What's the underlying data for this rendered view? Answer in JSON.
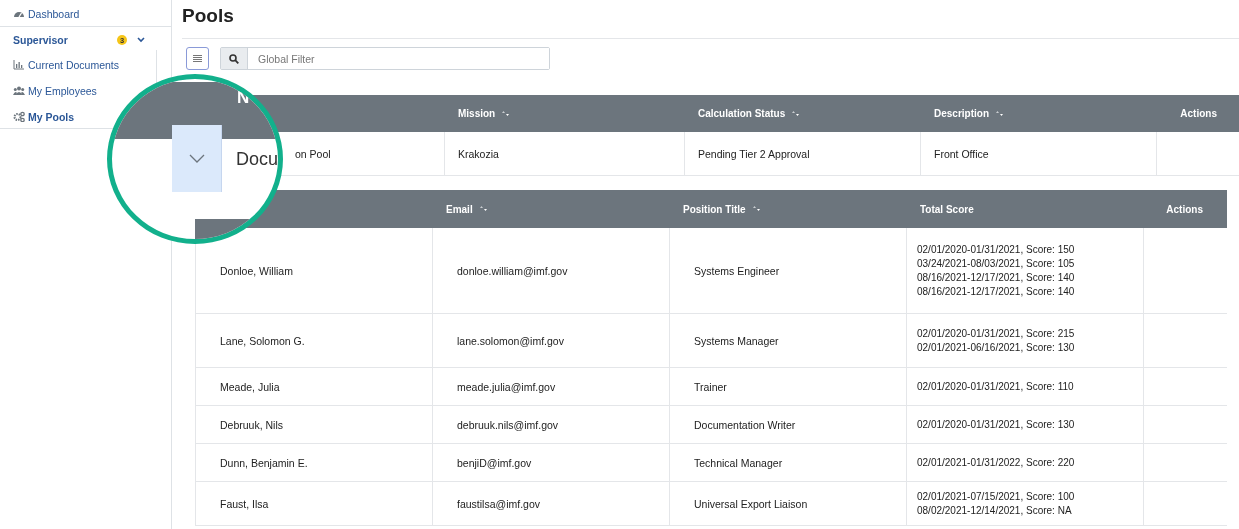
{
  "sidebar": {
    "items": [
      {
        "kind": "link",
        "label": "Dashboard",
        "selected": false
      },
      {
        "kind": "group",
        "label": "Supervisor",
        "badge": "3",
        "expanded": true,
        "children": [
          {
            "label": "Current Documents",
            "selected": false
          },
          {
            "label": "My Employees",
            "selected": false
          },
          {
            "label": "My Pools",
            "selected": true
          }
        ]
      }
    ]
  },
  "title": "Pools",
  "toolbar": {
    "filter_placeholder": "Global Filter"
  },
  "pools_table": {
    "columns": [
      {
        "label": "Mission",
        "sortable": true
      },
      {
        "label": "Calculation Status",
        "sortable": true
      },
      {
        "label": "Description",
        "sortable": true
      },
      {
        "label": "Actions",
        "sortable": false
      }
    ],
    "rows": [
      {
        "expanded": true,
        "name": "on Pool",
        "mission": "Krakozia",
        "calculation_status": "Pending Tier 2 Approval",
        "description": "Front Office"
      }
    ]
  },
  "magnifier": {
    "header_text": "N",
    "row_text": "Docu"
  },
  "employees_table": {
    "columns": [
      {
        "label": "Email",
        "sortable": true
      },
      {
        "label": "Position Title",
        "sortable": true
      },
      {
        "label": "Total Score",
        "sortable": false
      },
      {
        "label": "Actions",
        "sortable": false
      }
    ],
    "rows": [
      {
        "name": "Donloe, William",
        "email": "donloe.william@imf.gov",
        "position": "Systems Engineer",
        "scores": [
          "02/01/2020-01/31/2021, Score: 150",
          "03/24/2021-08/03/2021, Score: 105",
          "08/16/2021-12/17/2021, Score: 140",
          "08/16/2021-12/17/2021, Score: 140"
        ]
      },
      {
        "name": "Lane, Solomon G.",
        "email": "lane.solomon@imf.gov",
        "position": "Systems Manager",
        "scores": [
          "02/01/2020-01/31/2021, Score: 215",
          "02/01/2021-06/16/2021, Score: 130"
        ]
      },
      {
        "name": "Meade, Julia",
        "email": "meade.julia@imf.gov",
        "position": "Trainer",
        "scores": [
          "02/01/2020-01/31/2021, Score: 110"
        ]
      },
      {
        "name": "Debruuk, Nils",
        "email": "debruuk.nils@imf.gov",
        "position": "Documentation Writer",
        "scores": [
          "02/01/2020-01/31/2021, Score: 130"
        ]
      },
      {
        "name": "Dunn, Benjamin E.",
        "email": "benjiD@imf.gov",
        "position": "Technical Manager",
        "scores": [
          "02/01/2021-01/31/2022, Score: 220"
        ]
      },
      {
        "name": "Faust, Ilsa",
        "email": "faustilsa@imf.gov",
        "position": "Universal Export Liaison",
        "scores": [
          "02/01/2021-07/15/2021, Score: 100",
          "08/02/2021-12/14/2021, Score: NA"
        ]
      }
    ]
  }
}
